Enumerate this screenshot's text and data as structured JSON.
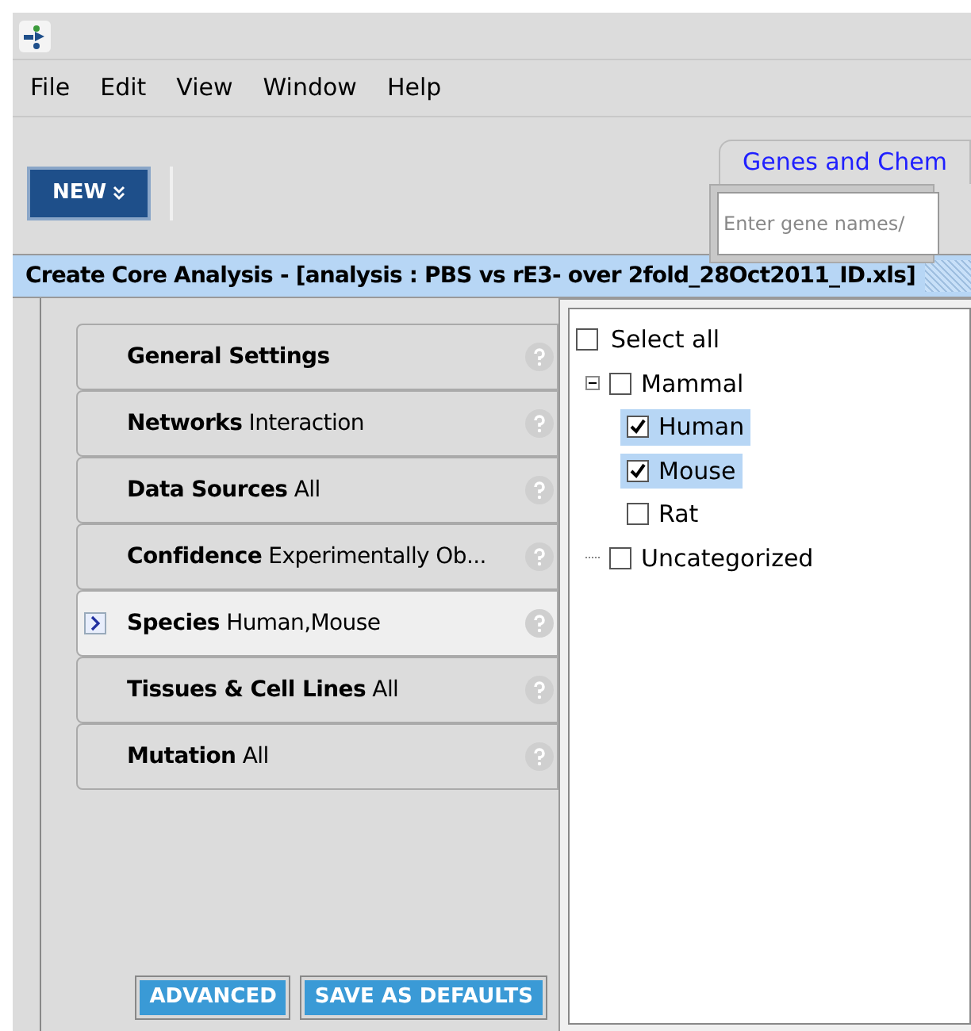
{
  "menu": [
    "File",
    "Edit",
    "View",
    "Window",
    "Help"
  ],
  "toolbar": {
    "new_button": "NEW"
  },
  "search": {
    "tab": "Genes and Chem",
    "placeholder": "Enter gene names/"
  },
  "panel_title": "Create Core Analysis - [analysis : PBS vs rE3- over 2fold_28Oct2011_ID.xls]",
  "settings": [
    {
      "name": "General Settings",
      "selected": false
    },
    {
      "name": "Networks",
      "value": "Interaction",
      "selected": false
    },
    {
      "name": "Data Sources",
      "value": "All",
      "selected": false
    },
    {
      "name": "Confidence",
      "value": "Experimentally Ob...",
      "selected": false
    },
    {
      "name": "Species",
      "value": "Human,Mouse",
      "selected": true
    },
    {
      "name": "Tissues & Cell Lines",
      "value": "All",
      "selected": false
    },
    {
      "name": "Mutation",
      "value": "All",
      "selected": false
    }
  ],
  "select_all": {
    "label": "Select all",
    "checked": false
  },
  "tree": [
    {
      "label": "Mammal",
      "checked": false,
      "expanded": true,
      "children": [
        {
          "label": "Human",
          "checked": true,
          "selected": true
        },
        {
          "label": "Mouse",
          "checked": true,
          "selected": true
        },
        {
          "label": "Rat",
          "checked": false,
          "selected": false
        }
      ]
    },
    {
      "label": "Uncategorized",
      "checked": false
    }
  ],
  "buttons": [
    "ADVANCED",
    "SAVE AS DEFAULTS"
  ]
}
